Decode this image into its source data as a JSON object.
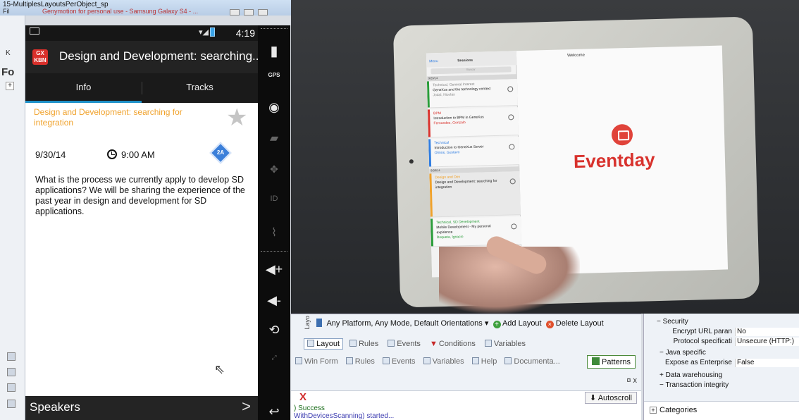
{
  "ide": {
    "title": "15-MultiplesLayoutsPerObject_sp",
    "subtitle_prefix": "Fil",
    "genymotion_title": "Genymotion for personal use - Samsung Galaxy S4 - ...",
    "left_letter_k": "K",
    "left_fo": "Fo",
    "left_plus": "+"
  },
  "phone": {
    "status_time": "4:19",
    "app_logo_text": "GX KBN",
    "action_title": "Design and Development: searching...",
    "tabs": [
      "Info",
      "Tracks"
    ],
    "headline": "Design and Development: searching for integration",
    "date": "9/30/14",
    "time": "9:00 AM",
    "badge": "2A",
    "description": "What is the process we currently apply to develop SD applications? We will be sharing the experience of the past year in design and development for SD applications.",
    "bottom_label": "Speakers",
    "bottom_chevron": ">"
  },
  "emulator_tools": {
    "gps": "GPS",
    "id": "ID"
  },
  "tablet": {
    "sessions_title": "Sessions",
    "menu": "Menu",
    "search": "Buscar",
    "welcome": "Welcome",
    "brand": "Eventday",
    "day1": "9/29/14",
    "day2": "9/30/14",
    "items": [
      {
        "track": "Technical, General Interest",
        "title": "GeneXus and the technology context",
        "speaker": "Jodal, Nicolás",
        "color": "#2a9d3a"
      },
      {
        "track": "BPM",
        "title": "Introduction to BPM in GeneXus",
        "speaker": "Fernandez, Gonzalo",
        "color": "#d9302b"
      },
      {
        "track": "Technical",
        "title": "Introduction to GeneXus Server",
        "speaker": "Olmos, Gustavo",
        "color": "#2f7de1"
      },
      {
        "track": "Design and Dev",
        "title": "Design and Development: searching for integration",
        "speaker": "",
        "color": "#f0a22c"
      },
      {
        "track": "Technical, SD Development",
        "title": "Mobile Development - My personal expirience",
        "speaker": "Roqueta, Ignacio",
        "color": "#2a9d3a"
      }
    ]
  },
  "layout_editor": {
    "vertical_label": "Layo",
    "platform_label": "Any Platform, Any Mode, Default Orientations",
    "dropdown_arrow": "▾",
    "add_layout": "Add Layout",
    "delete_layout": "Delete Layout",
    "subtabs": [
      "Layout",
      "Rules",
      "Events",
      "Conditions",
      "Variables"
    ],
    "main_tabs": [
      "Win Form",
      "Rules",
      "Events",
      "Variables",
      "Help",
      "Documenta..."
    ],
    "patterns_tab": "Patterns",
    "pin": "¤ x",
    "output_close": "X",
    "autoscroll": "Autoscroll",
    "output_line1": ") Success",
    "output_line2": "WithDevicesScanning) started..."
  },
  "properties": {
    "security_group": "Security",
    "rows": [
      {
        "key": "Encrypt URL paran",
        "value": "No"
      },
      {
        "key": "Protocol specificati",
        "value": "Unsecure (HTTP:)"
      }
    ],
    "java_group": "Java specific",
    "expose_row": {
      "key": "Expose as Enterprise",
      "value": "False"
    },
    "data_warehousing": "Data warehousing",
    "transaction_integrity": "Transaction integrity",
    "categories": "Categories"
  }
}
